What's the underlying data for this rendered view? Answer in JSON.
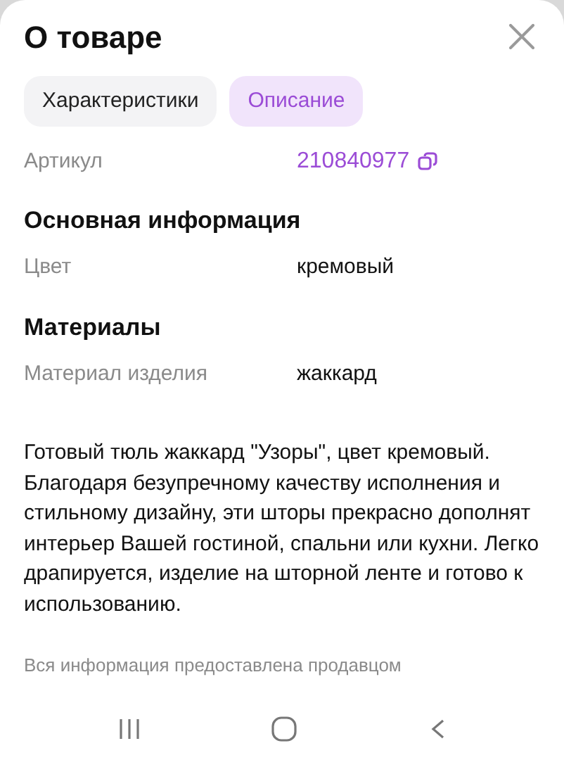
{
  "title": "О товаре",
  "tabs": [
    {
      "label": "Характеристики",
      "selected": false
    },
    {
      "label": "Описание",
      "selected": true
    }
  ],
  "article": {
    "label": "Артикул",
    "value": "210840977"
  },
  "sections": [
    {
      "heading": "Основная информация",
      "rows": [
        {
          "label": "Цвет",
          "value": "кремовый"
        }
      ]
    },
    {
      "heading": "Материалы",
      "rows": [
        {
          "label": "Материал изделия",
          "value": "жаккард"
        }
      ]
    }
  ],
  "description": "Готовый тюль жаккард \"Узоры\", цвет кремовый. Благодаря безупречному качеству исполнения и стильному дизайну, эти шторы прекрасно дополнят интерьер Вашей гостиной, спальни или кухни. Легко драпируется, изделие на шторной ленте и готово к использованию.",
  "footer": "Вся информация предоставлена продавцом"
}
